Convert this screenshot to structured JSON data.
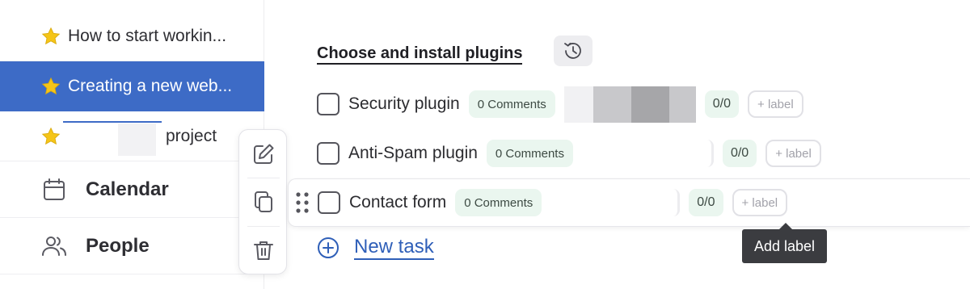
{
  "sidebar": {
    "projects": [
      {
        "label": "How to start workin...",
        "icon": "star-icon"
      },
      {
        "label": "Creating a new web...",
        "icon": "star-icon",
        "active": true
      },
      {
        "label": "project",
        "icon": "star-icon"
      }
    ],
    "nav": [
      {
        "label": "Calendar",
        "icon": "calendar-icon"
      },
      {
        "label": "People",
        "icon": "people-icon"
      }
    ]
  },
  "row_actions": [
    "edit-icon",
    "copy-icon",
    "trash-icon"
  ],
  "task_group": {
    "title": "Choose and install plugins",
    "history_icon": "history-icon"
  },
  "tasks": [
    {
      "name": "Security plugin",
      "comments": "0 Comments",
      "count": "0/0",
      "label_button": "+ label"
    },
    {
      "name": "Anti-Spam plugin",
      "comments": "0 Comments",
      "count": "0/0",
      "label_button": "+ label"
    },
    {
      "name": "Contact form",
      "comments": "0 Comments",
      "count": "0/0",
      "label_button": "+ label"
    }
  ],
  "tooltip": "Add label",
  "new_task": "New task",
  "colors": {
    "accent": "#3d6bc6",
    "link": "#2f5fb8",
    "pill_bg": "#eaf6ef",
    "star": "#f5c518",
    "tooltip_bg": "#3b3c40"
  }
}
